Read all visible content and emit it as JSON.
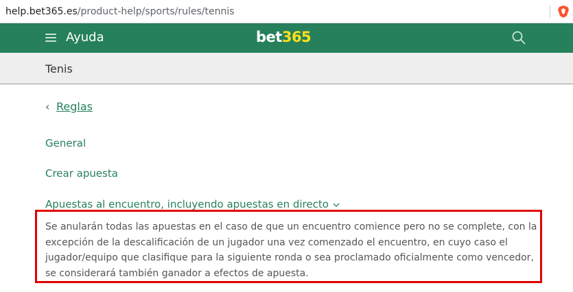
{
  "browser": {
    "url_host": "help.bet365.es",
    "url_path": "/product-help/sports/rules/tennis"
  },
  "header": {
    "menu_icon": "hamburger-menu-icon",
    "title": "Ayuda",
    "logo_bet": "bet",
    "logo_num": "365",
    "search_icon": "search-icon",
    "colors": {
      "brand_green": "#26805b",
      "logo_yellow": "#ffdf1b"
    }
  },
  "subheader": {
    "title": "Tenis"
  },
  "nav": {
    "back_label": "Reglas",
    "items": [
      {
        "label": "General"
      },
      {
        "label": "Crear apuesta"
      },
      {
        "label": "Apuestas al encuentro, incluyendo apuestas en directo",
        "expanded": true
      }
    ]
  },
  "content": {
    "rule_text": "Se anularán todas las apuestas en el caso de que un encuentro comience pero no se complete, con la excepción de la descalificación de un jugador una vez comenzado el encuentro, en cuyo caso el jugador/equipo que clasifique para la siguiente ronda o sea proclamado oficialmente como vencedor, se considerará también ganador a efectos de apuesta."
  },
  "annotation": {
    "highlight_color": "#e00000"
  }
}
